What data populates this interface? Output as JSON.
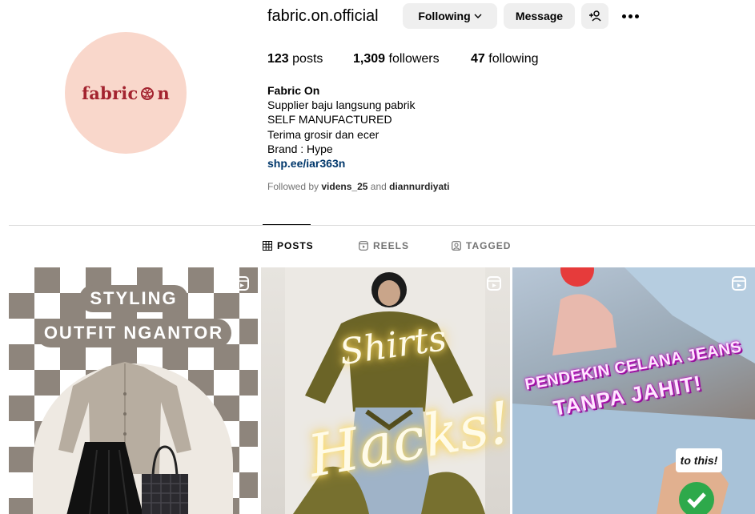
{
  "profile": {
    "username": "fabric.on.official",
    "avatar_logo": "fabric on",
    "avatar_logo_part1": "fabric",
    "avatar_logo_part2": "n"
  },
  "actions": {
    "following_label": "Following",
    "message_label": "Message"
  },
  "stats": {
    "posts_count": "123",
    "posts_label": "posts",
    "followers_count": "1,309",
    "followers_label": "followers",
    "following_count": "47",
    "following_label": "following"
  },
  "bio": {
    "name": "Fabric On",
    "lines": [
      "Supplier baju langsung pabrik",
      "SELF MANUFACTURED",
      "Terima grosir dan ecer",
      "Brand : Hype"
    ],
    "link": "shp.ee/iar363n"
  },
  "followed_by": {
    "prefix": "Followed by",
    "user1": "videns_25",
    "conjunction": "and",
    "user2": "diannurdiyati"
  },
  "tabs": [
    {
      "label": "POSTS",
      "icon": "grid-icon",
      "active": true
    },
    {
      "label": "REELS",
      "icon": "reels-icon",
      "active": false
    },
    {
      "label": "TAGGED",
      "icon": "tagged-icon",
      "active": false
    }
  ],
  "posts": [
    {
      "line1": "STYLING",
      "line2": "OUTFIT NGANTOR",
      "type": "reel"
    },
    {
      "line1": "Shirts",
      "line2": "Hacks!!",
      "type": "reel"
    },
    {
      "line1": "PENDEKIN CELANA JEANS",
      "line2": "TANPA JAHIT!",
      "caption": "to this!",
      "type": "reel"
    }
  ],
  "colors": {
    "avatar_bg": "#f9d7cb",
    "logo_red": "#a3232f",
    "link_blue": "#00376b",
    "button_bg": "#efefef"
  }
}
